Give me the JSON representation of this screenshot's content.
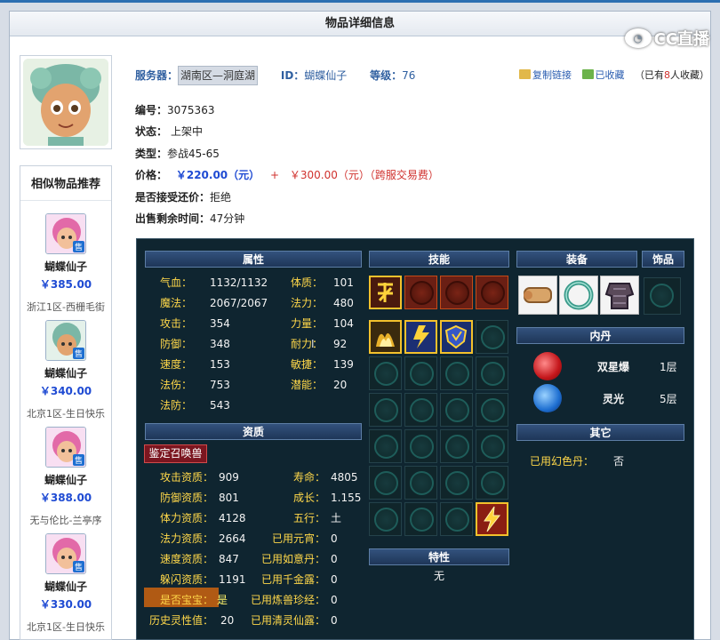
{
  "page": {
    "title": "物品详细信息"
  },
  "watermark": {
    "text": "CC直播"
  },
  "header": {
    "server_label": "服务器：",
    "server_value": "湖南区—洞庭湖",
    "id_label": "ID：",
    "id_value": "蝴蝶仙子",
    "level_label": "等级：",
    "level_value": "76",
    "copy_link": "复制链接",
    "favorited": "已收藏",
    "fav_prefix": "（已有",
    "fav_count": "8",
    "fav_suffix": "人收藏）"
  },
  "item": {
    "serial_label": "编号：",
    "serial_value": "3075363",
    "status_label": "状态：",
    "status_value": "上架中",
    "type_label": "类型：",
    "type_value": "参战45-65",
    "price_label": "价格：",
    "price_value": "￥220.00（元）",
    "price_plus": "+",
    "price_cross": "￥300.00（元）（跨服交易费）",
    "counter_label": "是否接受还价：",
    "counter_value": "拒绝",
    "remain_label": "出售剩余时间：",
    "remain_value": "47分钟"
  },
  "recommend": {
    "title": "相似物品推荐",
    "sell_tag": "售",
    "items": [
      {
        "name": "蝴蝶仙子",
        "price": "￥385.00",
        "server": "浙江1区-西栅毛街"
      },
      {
        "name": "蝴蝶仙子",
        "price": "￥340.00",
        "server": "北京1区-生日快乐"
      },
      {
        "name": "蝴蝶仙子",
        "price": "￥388.00",
        "server": "无与伦比-兰亭序"
      },
      {
        "name": "蝴蝶仙子",
        "price": "￥330.00",
        "server": "北京1区-生日快乐"
      }
    ]
  },
  "panel": {
    "attr_header": "属性",
    "skill_header": "技能",
    "equip_header": "装备",
    "ornament_header": "饰品",
    "neidan_header": "内丹",
    "other_header": "其它",
    "zizhi_header": "资质",
    "trait_header": "特性",
    "trait_value": "无",
    "summon_button": "鉴定召唤兽",
    "attrs_left": [
      {
        "k": "气血：",
        "v": "1132/1132"
      },
      {
        "k": "魔法：",
        "v": "2067/2067"
      },
      {
        "k": "攻击：",
        "v": "354"
      },
      {
        "k": "防御：",
        "v": "348"
      },
      {
        "k": "速度：",
        "v": "153"
      },
      {
        "k": "法伤：",
        "v": "753"
      },
      {
        "k": "法防：",
        "v": "543"
      }
    ],
    "attrs_right": [
      {
        "k": "体质：",
        "v": "101"
      },
      {
        "k": "法力：",
        "v": "480"
      },
      {
        "k": "力量：",
        "v": "104"
      },
      {
        "k": "耐力：",
        "v": "92"
      },
      {
        "k": "敏捷：",
        "v": "139"
      },
      {
        "k": "潜能：",
        "v": "20"
      }
    ],
    "zizhi_left": [
      {
        "k": "攻击资质：",
        "v": "909"
      },
      {
        "k": "防御资质：",
        "v": "801"
      },
      {
        "k": "体力资质：",
        "v": "4128"
      },
      {
        "k": "法力资质：",
        "v": "2664"
      },
      {
        "k": "速度资质：",
        "v": "847"
      },
      {
        "k": "躲闪资质：",
        "v": "1191"
      },
      {
        "k": "是否宝宝：",
        "v": "是"
      },
      {
        "k": "历史灵性值：",
        "v": "20"
      }
    ],
    "zizhi_right": [
      {
        "k": "寿命：",
        "v": "4805"
      },
      {
        "k": "成长：",
        "v": "1.155"
      },
      {
        "k": "五行：",
        "v": "土"
      },
      {
        "k": "已用元宵：",
        "v": "0"
      },
      {
        "k": "已用如意丹：",
        "v": "0"
      },
      {
        "k": "已用千金露：",
        "v": "0"
      },
      {
        "k": "已用炼兽珍经：",
        "v": "0"
      },
      {
        "k": "已用清灵仙露：",
        "v": "0"
      }
    ],
    "neidan": [
      {
        "name": "双星爆",
        "level": "1层"
      },
      {
        "name": "灵光",
        "level": "5层"
      }
    ],
    "other": {
      "k": "已用幻色丹：",
      "v": "否"
    }
  },
  "colors": {
    "accent_blue": "#2f5fa0",
    "price_blue": "#1f4bd3",
    "price_red": "#d0312d",
    "label_yellow": "#ffd84a"
  }
}
